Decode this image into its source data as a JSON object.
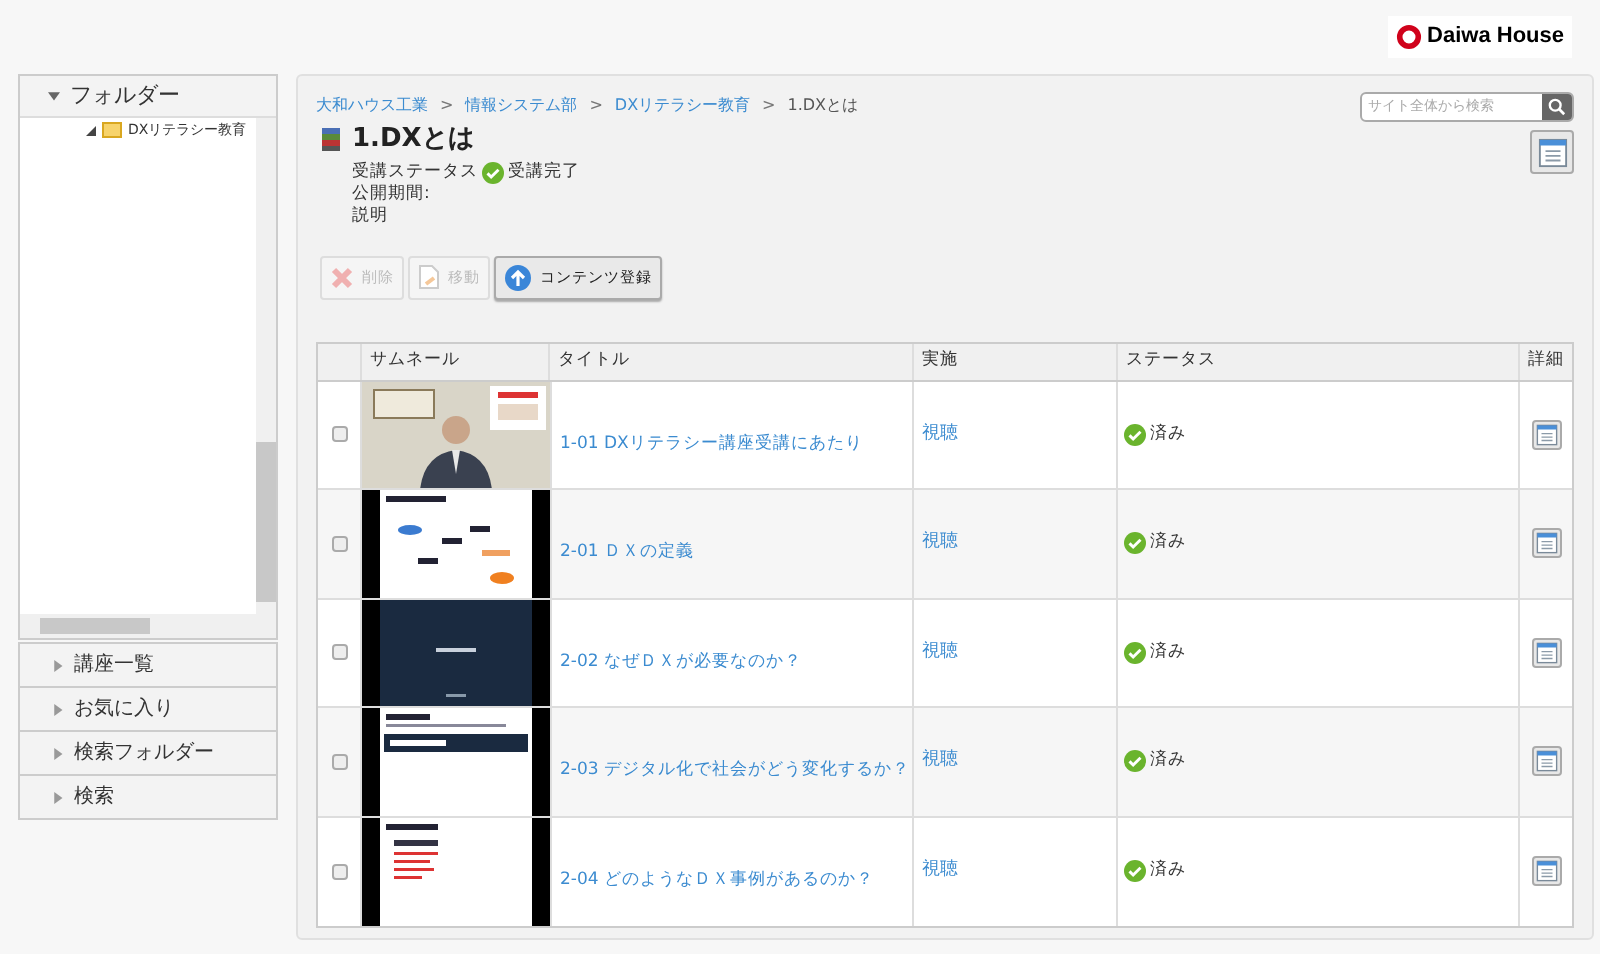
{
  "header": {
    "logo": "Daiwa House"
  },
  "sidebar": {
    "folder_panel": {
      "title": "フォルダー",
      "expanded": true,
      "tree": [
        {
          "label": "DXリテラシー教育",
          "expanded": true
        }
      ]
    },
    "sections": [
      {
        "label": "講座一覧",
        "expanded": false
      },
      {
        "label": "お気に入り",
        "expanded": false
      },
      {
        "label": "検索フォルダー",
        "expanded": false
      },
      {
        "label": "検索",
        "expanded": false
      }
    ]
  },
  "breadcrumb": [
    {
      "label": "大和ハウス工業",
      "link": true
    },
    {
      "separator": ">",
      "label": "情報システム部",
      "link": true
    },
    {
      "separator": ">",
      "label": "DXリテラシー教育",
      "link": true
    },
    {
      "separator": ">",
      "label": "1.DXとは",
      "link": false
    }
  ],
  "search": {
    "placeholder": "サイト全体から検索"
  },
  "content": {
    "title": "1.DXとは",
    "status_label": "受講ステータス",
    "status_value": "受講完了",
    "period_label": "公開期間:",
    "description_label": "説明"
  },
  "buttons": [
    {
      "label": "削除",
      "kind": "delete",
      "disabled": true
    },
    {
      "label": "移動",
      "kind": "move",
      "disabled": true
    },
    {
      "label": "コンテンツ登録",
      "kind": "upload",
      "disabled": false
    }
  ],
  "table": {
    "columns": [
      "サムネール",
      "タイトル",
      "実施",
      "ステータス",
      "詳細"
    ],
    "rows": [
      {
        "checked": false,
        "title": "1-01 DXリテラシー講座受講にあたり",
        "action": "視聴",
        "status": "済み"
      },
      {
        "checked": false,
        "title": "2-01 ＤＸの定義",
        "action": "視聴",
        "status": "済み"
      },
      {
        "checked": false,
        "title": "2-02 なぜＤＸが必要なのか？",
        "action": "視聴",
        "status": "済み"
      },
      {
        "checked": false,
        "title": "2-03 デジタル化で社会がどう変化するか？",
        "action": "視聴",
        "status": "済み"
      },
      {
        "checked": false,
        "title": "2-04 どのようなＤＸ事例があるのか？",
        "action": "視聴",
        "status": "済み"
      }
    ]
  }
}
